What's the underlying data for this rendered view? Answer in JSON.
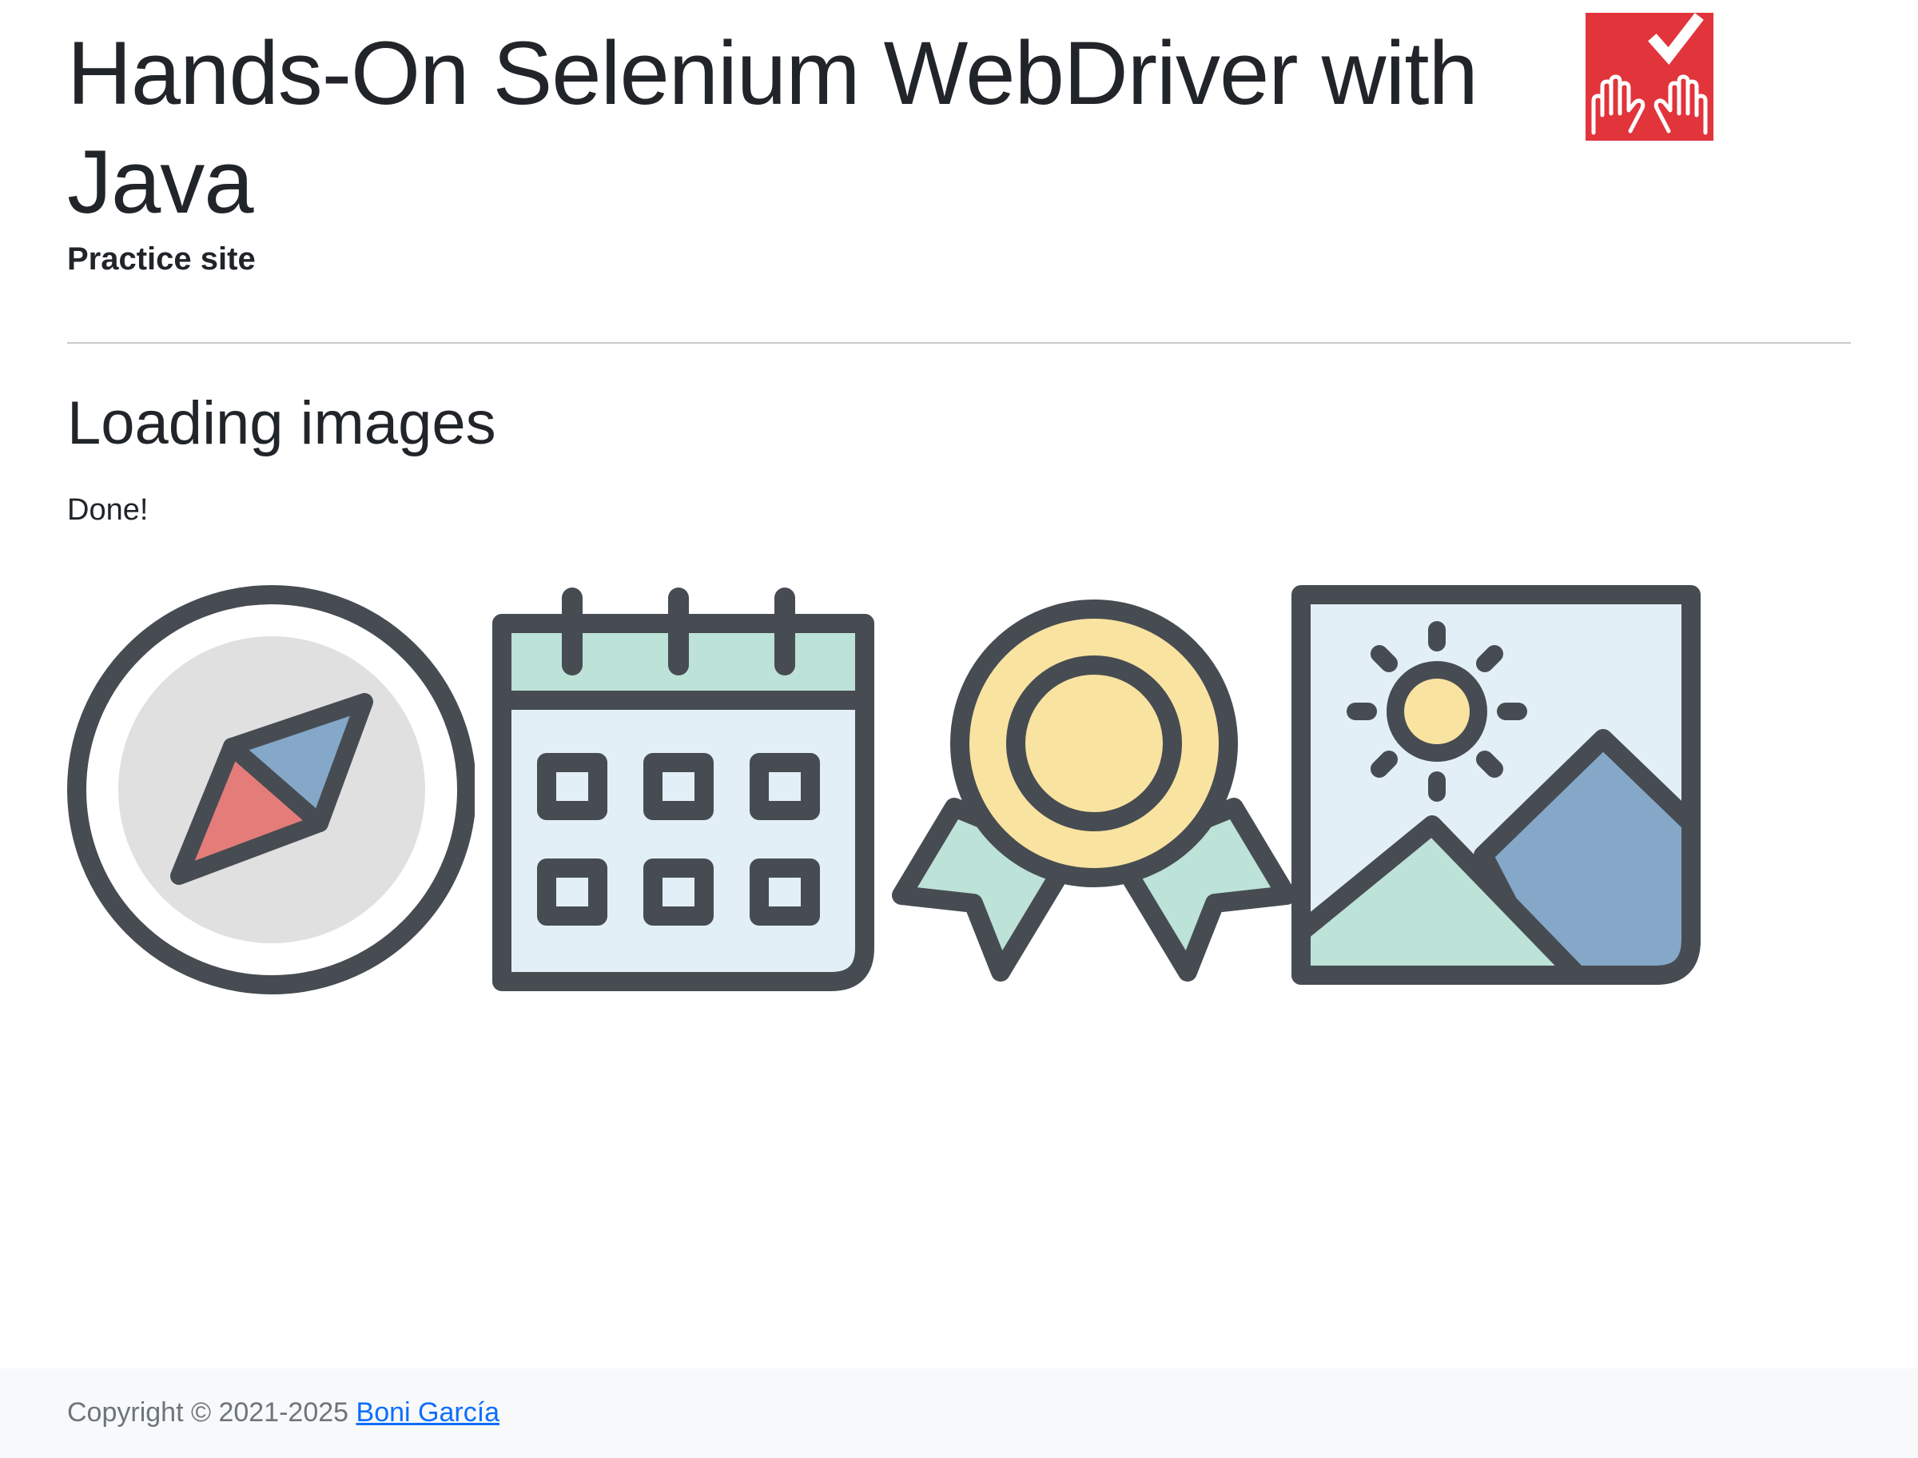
{
  "header": {
    "title": "Hands-On Selenium WebDriver with Java",
    "subtitle": "Practice site",
    "logo_alt": "Hands-On Selenium WebDriver logo"
  },
  "main": {
    "section_title": "Loading images",
    "status": "Done!",
    "images": [
      {
        "name": "compass-icon"
      },
      {
        "name": "calendar-icon"
      },
      {
        "name": "award-icon"
      },
      {
        "name": "landscape-icon"
      }
    ]
  },
  "footer": {
    "copyright": "Copyright © 2021-2025",
    "author_link": "Boni García"
  },
  "colors": {
    "logo_red": "#e1343b",
    "icon_stroke": "#474c53",
    "compass_fill": "#e0e0e0",
    "compass_blue": "#85a8c8",
    "compass_red": "#e47c79",
    "calendar_mint": "#bde2d8",
    "calendar_body": "#e2eff6",
    "award_yellow": "#f9e3a0",
    "link_blue": "#0d6efd"
  }
}
